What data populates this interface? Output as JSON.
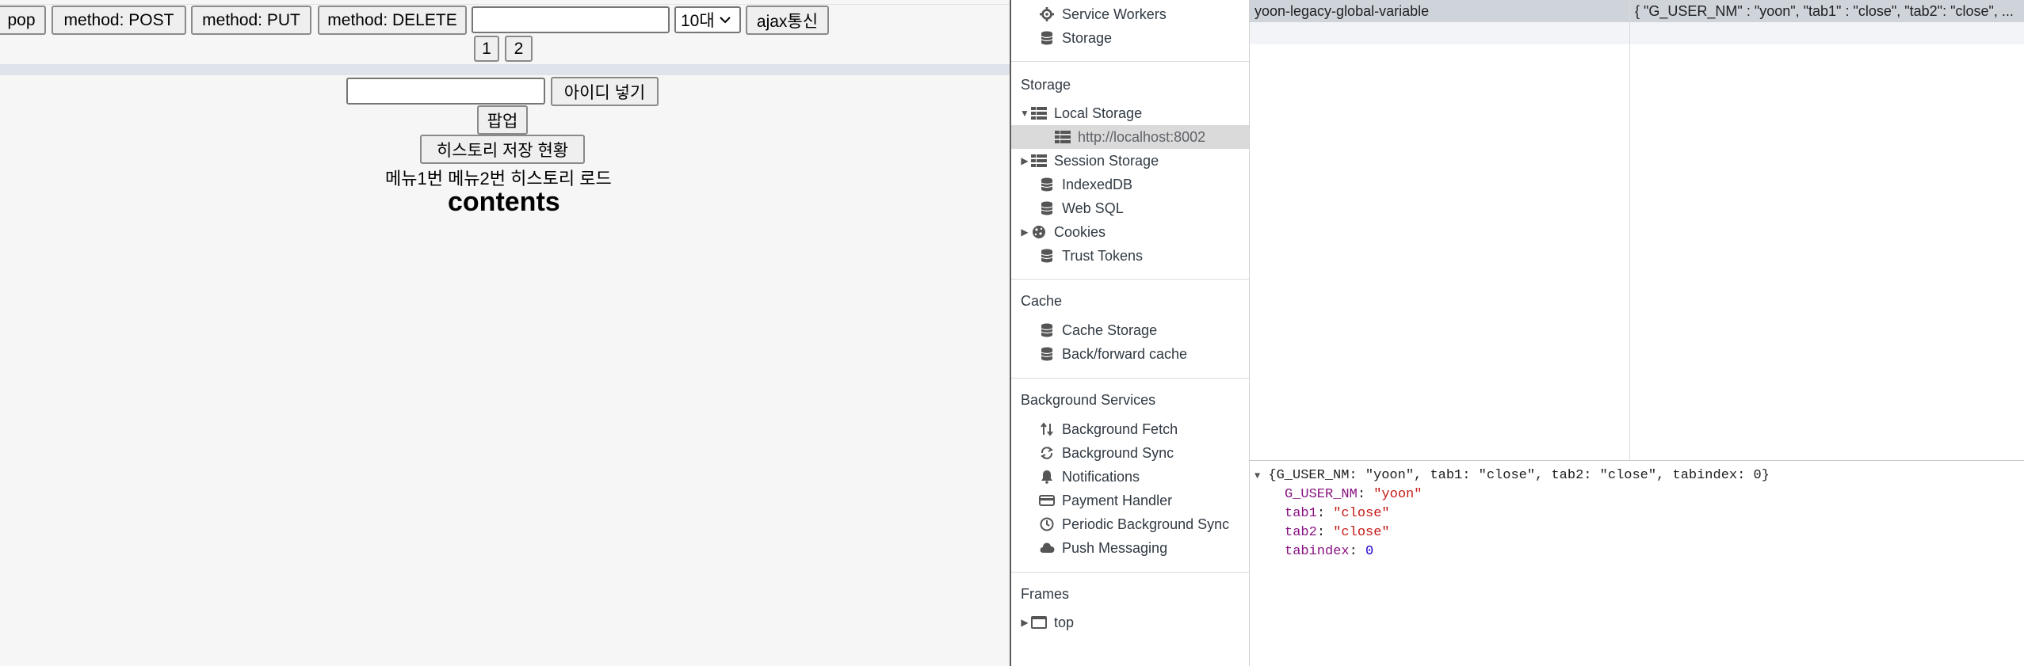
{
  "page": {
    "buttons": {
      "pop": "pop",
      "post": "method: POST",
      "put": "method: PUT",
      "delete": "method: DELETE",
      "ajax": "ajax통신",
      "page1": "1",
      "page2": "2",
      "put_id": "아이디 넣기",
      "popup": "팝업",
      "history_status": "히스토리 저장 현황"
    },
    "age_select": {
      "value": "10대"
    },
    "menu_text": "메뉴1번 메뉴2번 히스토리 로드",
    "contents_title": "contents"
  },
  "devtools": {
    "sidebar": {
      "top_items": [
        {
          "label": "Service Workers",
          "icon": "gear-icon"
        },
        {
          "label": "Storage",
          "icon": "database-icon"
        }
      ],
      "sections": {
        "storage": "Storage",
        "cache": "Cache",
        "background_services": "Background Services",
        "frames": "Frames"
      },
      "storage_items": {
        "local_storage": "Local Storage",
        "local_origin": "http://localhost:8002",
        "session_storage": "Session Storage",
        "indexeddb": "IndexedDB",
        "websql": "Web SQL",
        "cookies": "Cookies",
        "trust_tokens": "Trust Tokens"
      },
      "cache_items": {
        "cache_storage": "Cache Storage",
        "bf_cache": "Back/forward cache"
      },
      "bg_items": {
        "fetch": "Background Fetch",
        "sync": "Background Sync",
        "notifications": "Notifications",
        "payment": "Payment Handler",
        "periodic": "Periodic Background Sync",
        "push": "Push Messaging"
      },
      "frames_items": {
        "top": "top"
      }
    },
    "table": {
      "rows": [
        {
          "key": "yoon-legacy-global-variable",
          "value": "{ \"G_USER_NM\" : \"yoon\", \"tab1\" : \"close\", \"tab2\": \"close\", ..."
        }
      ]
    },
    "preview": {
      "summary": "{G_USER_NM: \"yoon\", tab1: \"close\", tab2: \"close\", tabindex: 0}",
      "props": [
        {
          "key": "G_USER_NM",
          "sep": ": ",
          "value": "\"yoon\"",
          "type": "str"
        },
        {
          "key": "tab1",
          "sep": ": ",
          "value": "\"close\"",
          "type": "str"
        },
        {
          "key": "tab2",
          "sep": ": ",
          "value": "\"close\"",
          "type": "str"
        },
        {
          "key": "tabindex",
          "sep": ": ",
          "value": "0",
          "type": "num"
        }
      ]
    },
    "colors": {
      "selected_row": "#cfd3da",
      "sidebar_selected": "#dadada",
      "key_color": "#881280",
      "string_color": "#c41a16",
      "number_color": "#1c00cf"
    }
  }
}
